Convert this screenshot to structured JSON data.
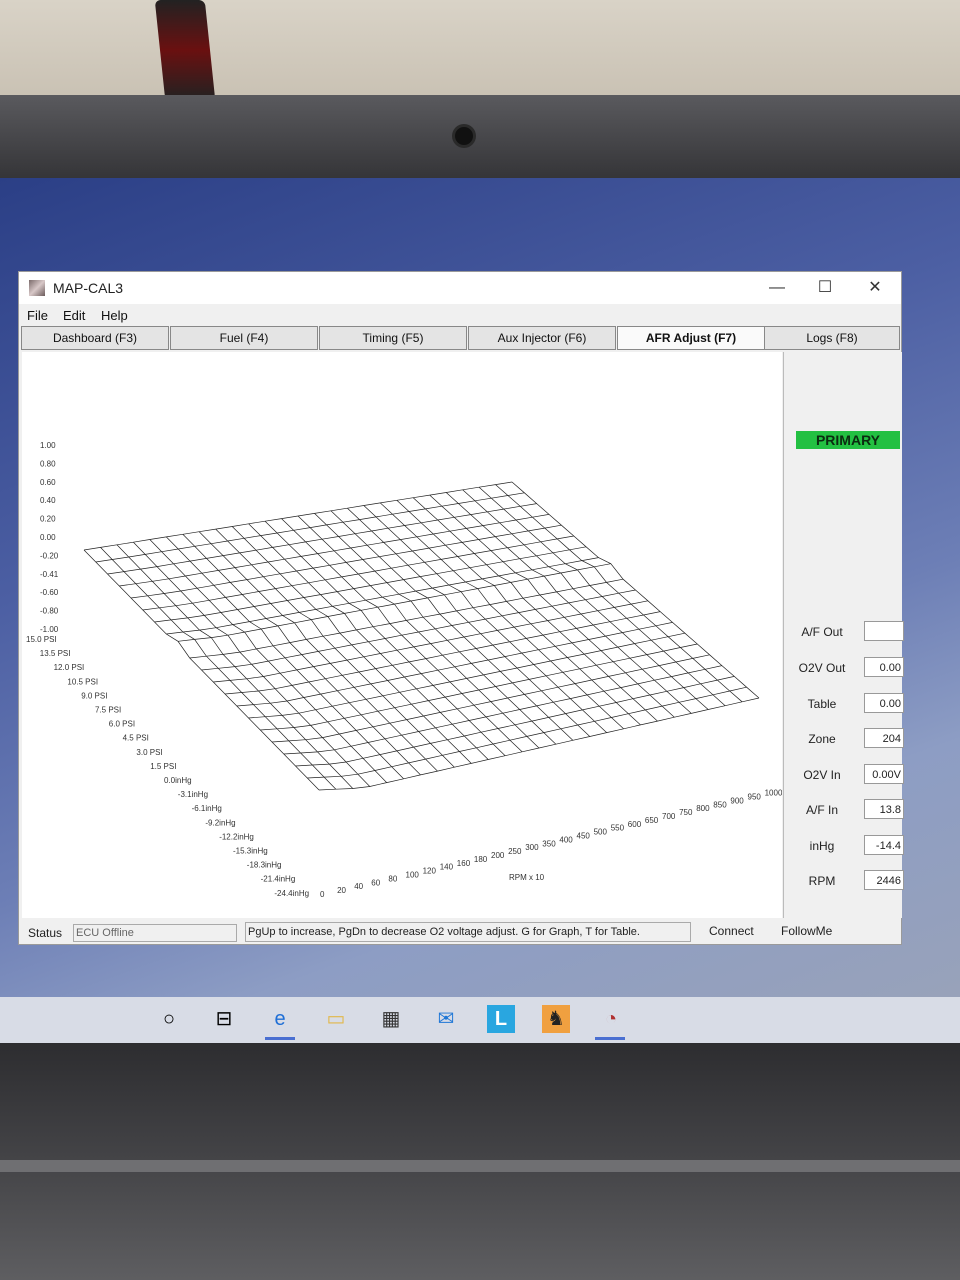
{
  "window": {
    "title": "MAP-CAL3",
    "controls": {
      "minimize": "—",
      "maximize": "☐",
      "close": "✕"
    }
  },
  "menu": [
    "File",
    "Edit",
    "Help"
  ],
  "tabs": [
    {
      "label": "Dashboard (F3)",
      "active": false
    },
    {
      "label": "Fuel (F4)",
      "active": false
    },
    {
      "label": "Timing (F5)",
      "active": false
    },
    {
      "label": "Aux Injector (F6)",
      "active": false
    },
    {
      "label": "AFR Adjust (F7)",
      "active": true
    },
    {
      "label": "Logs (F8)",
      "active": false
    }
  ],
  "graph": {
    "z_ticks": [
      "1.00",
      "0.80",
      "0.60",
      "0.40",
      "0.20",
      "0.00",
      "-0.20",
      "-0.41",
      "-0.60",
      "-0.80",
      "-1.00"
    ],
    "load_ticks": [
      "15.0 PSI",
      "13.5 PSI",
      "12.0 PSI",
      "10.5 PSI",
      "9.0 PSI",
      "7.5 PSI",
      "6.0 PSI",
      "4.5 PSI",
      "3.0 PSI",
      "1.5 PSI",
      "0.0inHg",
      "-3.1inHg",
      "-6.1inHg",
      "-9.2inHg",
      "-12.2inHg",
      "-15.3inHg",
      "-18.3inHg",
      "-21.4inHg",
      "-24.4inHg"
    ],
    "rpm_ticks": [
      "0",
      "20",
      "40",
      "60",
      "80",
      "100",
      "120",
      "140",
      "160",
      "180",
      "200",
      "250",
      "300",
      "350",
      "400",
      "450",
      "500",
      "550",
      "600",
      "650",
      "700",
      "750",
      "800",
      "850",
      "900",
      "950",
      "1000"
    ],
    "rpm_label": "RPM x 10"
  },
  "side": {
    "mode": "PRIMARY",
    "fields": [
      {
        "label": "A/F Out",
        "value": ""
      },
      {
        "label": "O2V Out",
        "value": "0.00"
      },
      {
        "label": "Table",
        "value": "0.00"
      },
      {
        "label": "Zone",
        "value": "204"
      },
      {
        "label": "O2V In",
        "value": "0.00V"
      },
      {
        "label": "A/F In",
        "value": "13.8"
      },
      {
        "label": "inHg",
        "value": "-14.4"
      },
      {
        "label": "RPM",
        "value": "2446"
      }
    ]
  },
  "status": {
    "label": "Status",
    "state": "ECU Offline",
    "message": "PgUp to increase, PgDn to decrease O2 voltage adjust. G for Graph, T for Table.",
    "connect": "Connect",
    "followme": "FollowMe"
  },
  "taskbar_icons": [
    "start-circle-icon",
    "task-view-icon",
    "edge-icon",
    "file-explorer-icon",
    "store-icon",
    "mail-icon",
    "l-app-icon",
    "app-icon",
    "mapcal-icon"
  ]
}
